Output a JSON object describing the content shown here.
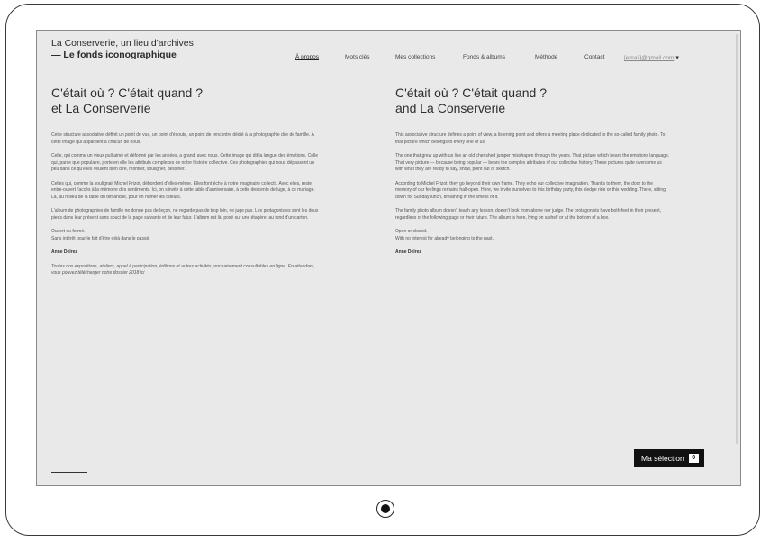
{
  "brand": {
    "line1": "La Conserverie, un lieu d'archives",
    "line2": "— Le fonds iconographique"
  },
  "nav": {
    "items": [
      {
        "label": "À propos",
        "active": true
      },
      {
        "label": "Mots clés",
        "active": false
      },
      {
        "label": "Mes collections",
        "active": false
      },
      {
        "label": "Fonds & albums",
        "active": false
      },
      {
        "label": "Méthode",
        "active": false
      },
      {
        "label": "Contact",
        "active": false
      }
    ],
    "user_email": "[email]@gmail.com"
  },
  "french": {
    "title_line1": "C'était où ? C'était quand ?",
    "title_line2": "et La Conserverie",
    "paragraphs": [
      "Cette structure associative définit un point de vue, un point d'écoute, un point de rencontre dédié à la photographie dite de famille. À cette image qui appartient à chacun de nous.",
      "Celle, qui comme un vieux pull aimé et déformé par les années, a grandi avec nous. Cette image qui dit la langue des émotions. Celle qui, parce que populaire, porte en elle les attributs complexes de notre histoire collective. Ces photographies qui nous dépassent un peu dans ce qu'elles veulent bien dire, montrer, souligner, dessiner.",
      "Celles qui, comme la soulignait Michel Frizot, débordent d'elles-même. Elles font écho à notre imaginaire collectif. Avec elles, reste entre-ouvert l'accès à la mémoire des sentiments. Ici, on s'invite à cette table d'anniversaire, à cette descente de luge, à ce mariage. Là, au milieu de la table du dimanche, pour en humer les odeurs.",
      "L'album de photographies de famille ne donne pas de leçon, ne regarde pas de trop loin, ne juge pas. Les protagonistes sont les deux pieds dans leur présent sans souci de la page suivante et de leur futur. L'album est là, posé sur une étagère, au fond d'un carton.",
      "Ouvert ou fermé.\nSans intérêt pour le fait d'être déjà dans le passé."
    ],
    "author": "Anne Delrez",
    "note": "Toutes nos expositions, ateliers, appel à participation, éditions et autres activités prochainement consultables en ligne. En attendant, vous pouvez télécharger notre dossier 2018 ici"
  },
  "english": {
    "title_line1": "C'était où ? C'était quand ?",
    "title_line2": "and La Conserverie",
    "paragraphs": [
      "This associative structure defines a point of view, a listening point and offers a meeting place dedicated to the so-called family photo. To that picture which belongs to every one of us.",
      "The one that grew up with us like an old cherished jumper misshapen through the years. That picture which hears the emotions language. That very picture — because being popular — bears the complex attributes of our collective history. These pictures quite overcome us with what they are ready to say, show, point out or sketch.",
      "According to Michel Frizot, they go beyond their own frame. They echo our collective imagination. Thanks to them, the door to the memory of our feelings remains half-open. Here, we invite ourselves to this birthday party, this sledge ride or this wedding. There, sitting down for Sunday lunch, breathing in the smells of it.",
      "The family photo album doesn't teach any lesson, doesn't look from above nor judge. The protagonists have both feet in their present, regardless of the following page or their future. The album is here, lying on a shelf or at the bottom of a box.",
      "Open or closed.\nWith no interest for already belonging to the past."
    ],
    "author": "Anne Delrez"
  },
  "selection": {
    "label": "Ma sélection",
    "count": "0"
  }
}
